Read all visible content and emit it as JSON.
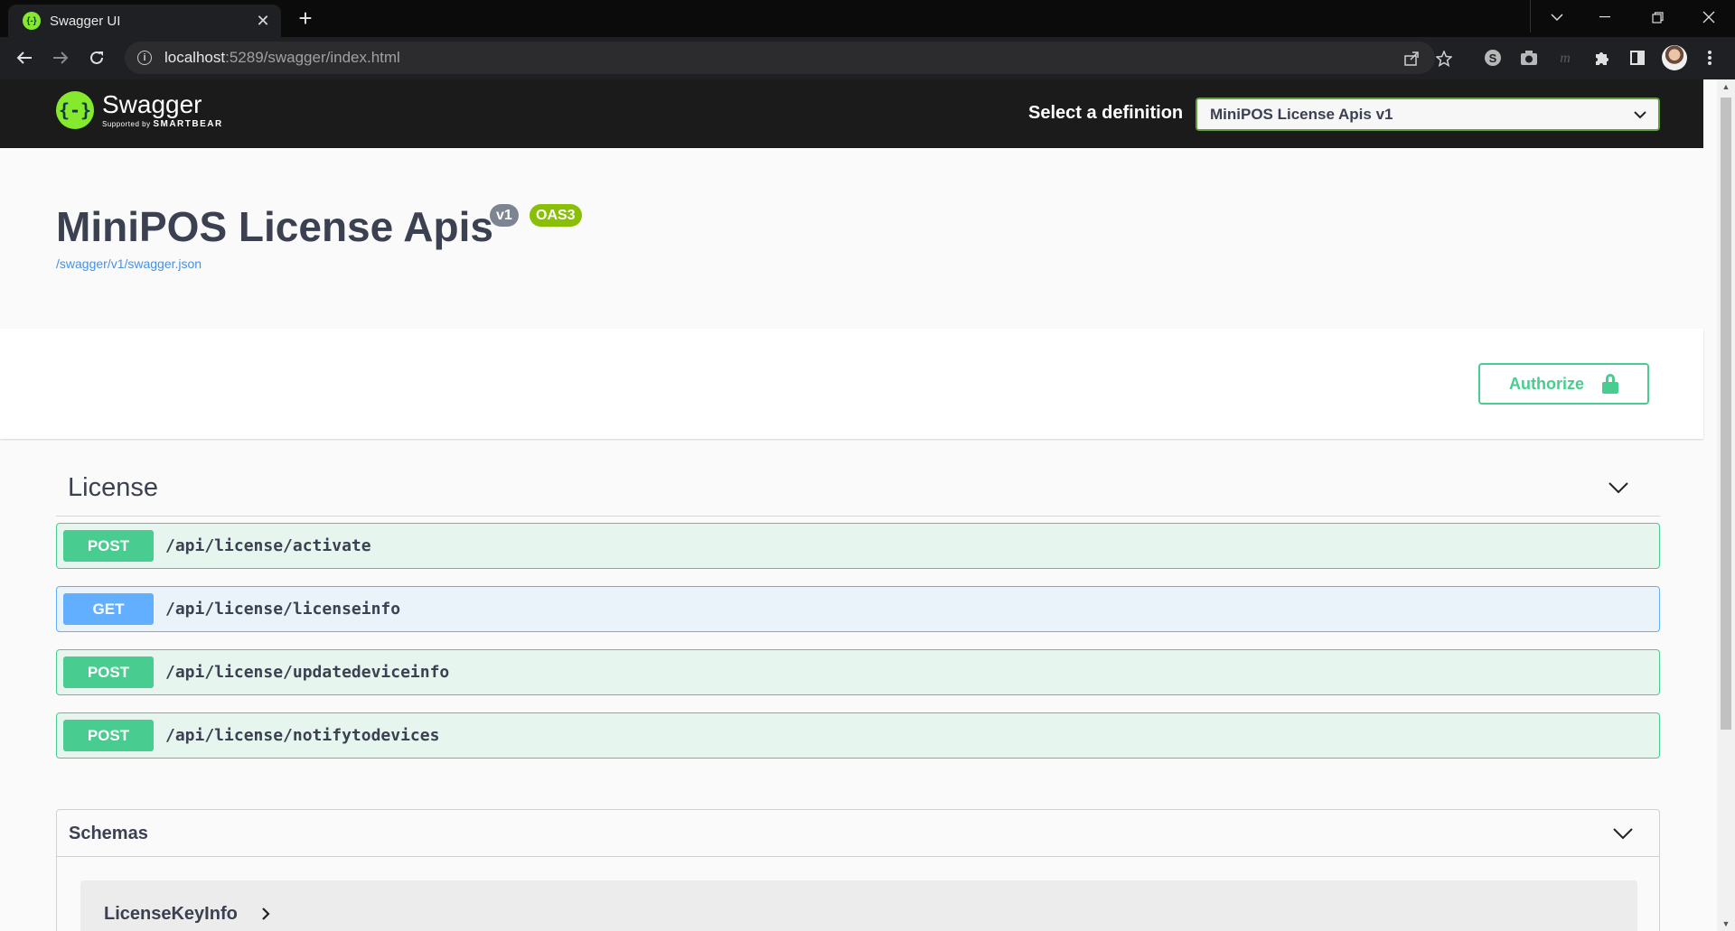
{
  "browser": {
    "tab_title": "Swagger UI",
    "tab_favicon": "{-}",
    "tab_close": "✕",
    "new_tab": "+",
    "url_host": "localhost",
    "url_path": ":5289/swagger/index.html",
    "info_icon": "i"
  },
  "swagger": {
    "logo_mark": "{-}",
    "logo_name": "Swagger",
    "logo_sub_prefix": "Supported by",
    "logo_sub_brand": "SMARTBEAR",
    "definition_label": "Select a definition",
    "definition_value": "MiniPOS License Apis v1",
    "title": "MiniPOS License Apis",
    "version_badge": "v1",
    "oas_badge": "OAS3",
    "json_link": "/swagger/v1/swagger.json",
    "authorize_label": "Authorize"
  },
  "tag": {
    "name": "License",
    "operations": [
      {
        "method": "POST",
        "path": "/api/license/activate"
      },
      {
        "method": "GET",
        "path": "/api/license/licenseinfo"
      },
      {
        "method": "POST",
        "path": "/api/license/updatedeviceinfo"
      },
      {
        "method": "POST",
        "path": "/api/license/notifytodevices"
      }
    ]
  },
  "schemas": {
    "title": "Schemas",
    "models": [
      {
        "name": "LicenseKeyInfo"
      }
    ]
  },
  "colors": {
    "post": "#49cc90",
    "get": "#61affe",
    "swagger_green": "#85ea2d",
    "topbar": "#1b1b1b"
  }
}
